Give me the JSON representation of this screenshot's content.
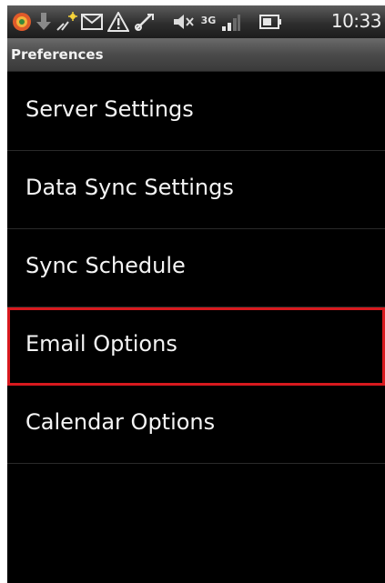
{
  "status_bar": {
    "time": "10:33",
    "icons": [
      "notification-app-icon",
      "download-icon",
      "wifi-signal-icon",
      "email-icon",
      "warning-icon",
      "usb-debug-icon",
      "mute-icon",
      "3g-icon",
      "signal-bars-icon",
      "battery-icon"
    ],
    "network_label": "3G"
  },
  "title_bar": {
    "title": "Preferences"
  },
  "menu": {
    "items": [
      {
        "label": "Server Settings"
      },
      {
        "label": "Data Sync Settings"
      },
      {
        "label": "Sync Schedule"
      },
      {
        "label": "Email Options",
        "highlighted": true
      },
      {
        "label": "Calendar Options"
      }
    ]
  },
  "colors": {
    "background": "#000000",
    "highlight": "#d8191e",
    "text": "#f4f4f4"
  }
}
